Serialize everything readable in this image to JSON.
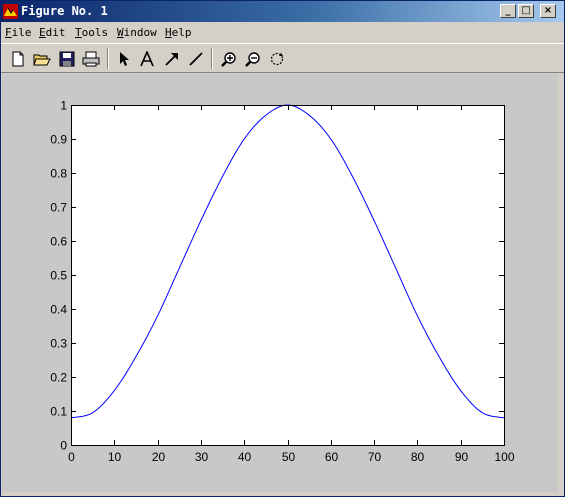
{
  "window": {
    "title": "Figure No. 1",
    "controls": {
      "minimize": "_",
      "maximize": "□",
      "close": "×"
    }
  },
  "menu": {
    "items": [
      "File",
      "Edit",
      "Tools",
      "Window",
      "Help"
    ]
  },
  "toolbar": {
    "tools": [
      "new-figure-icon",
      "open-file-icon",
      "save-icon",
      "print-icon",
      "select-arrow-icon",
      "insert-text-icon",
      "insert-arrow-icon",
      "insert-line-icon",
      "zoom-in-icon",
      "zoom-out-icon",
      "rotate-3d-icon"
    ]
  },
  "colors": {
    "line": "#0000ff",
    "figure_background": "#c8c8c8",
    "axes_background": "#ffffff"
  },
  "chart_data": {
    "type": "line",
    "title": "",
    "xlabel": "",
    "ylabel": "",
    "xlim": [
      0,
      100
    ],
    "ylim": [
      0,
      1
    ],
    "xticks": [
      "0",
      "10",
      "20",
      "30",
      "40",
      "50",
      "60",
      "70",
      "80",
      "90",
      "100"
    ],
    "yticks": [
      "0",
      "0.1",
      "0.2",
      "0.3",
      "0.4",
      "0.5",
      "0.6",
      "0.7",
      "0.8",
      "0.9",
      "1"
    ],
    "grid": false,
    "x": [
      0,
      5,
      10,
      15,
      20,
      25,
      30,
      35,
      40,
      45,
      50,
      55,
      60,
      65,
      70,
      75,
      80,
      85,
      90,
      95,
      100
    ],
    "y": [
      0.08,
      0.095,
      0.16,
      0.26,
      0.38,
      0.52,
      0.66,
      0.79,
      0.9,
      0.97,
      1.0,
      0.97,
      0.9,
      0.79,
      0.66,
      0.52,
      0.38,
      0.26,
      0.16,
      0.095,
      0.08
    ]
  }
}
